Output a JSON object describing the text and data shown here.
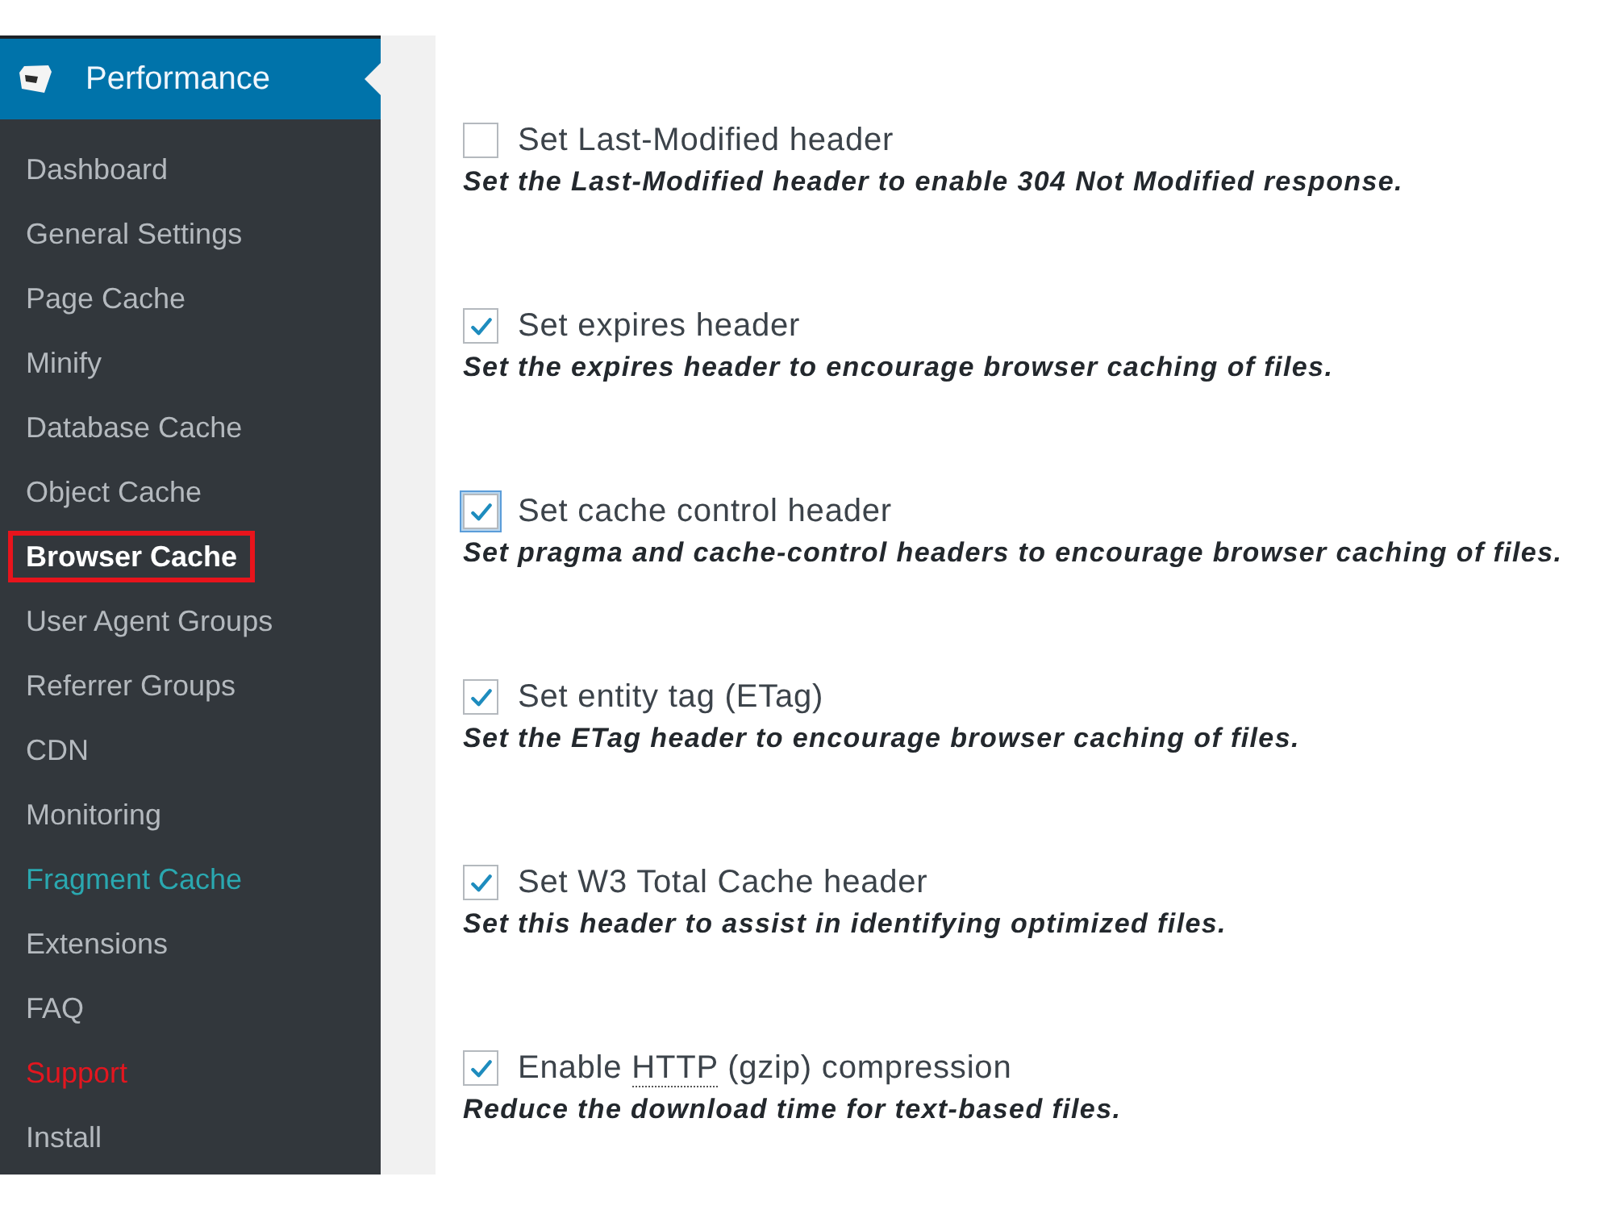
{
  "sidebar": {
    "header": {
      "title": "Performance"
    },
    "items": [
      {
        "label": "Dashboard",
        "selected": false,
        "marked": false,
        "color": "#b4b9be"
      },
      {
        "label": "General Settings",
        "selected": false,
        "marked": false,
        "color": "#b4b9be"
      },
      {
        "label": "Page Cache",
        "selected": false,
        "marked": false,
        "color": "#b4b9be"
      },
      {
        "label": "Minify",
        "selected": false,
        "marked": false,
        "color": "#b4b9be"
      },
      {
        "label": "Database Cache",
        "selected": false,
        "marked": false,
        "color": "#b4b9be"
      },
      {
        "label": "Object Cache",
        "selected": false,
        "marked": false,
        "color": "#b4b9be"
      },
      {
        "label": "Browser Cache",
        "selected": true,
        "marked": true,
        "color": "#ffffff"
      },
      {
        "label": "User Agent Groups",
        "selected": false,
        "marked": false,
        "color": "#b4b9be"
      },
      {
        "label": "Referrer Groups",
        "selected": false,
        "marked": false,
        "color": "#b4b9be"
      },
      {
        "label": "CDN",
        "selected": false,
        "marked": false,
        "color": "#b4b9be"
      },
      {
        "label": "Monitoring",
        "selected": false,
        "marked": false,
        "color": "#b4b9be"
      },
      {
        "label": "Fragment Cache",
        "selected": false,
        "marked": false,
        "color": "#2aa8b0"
      },
      {
        "label": "Extensions",
        "selected": false,
        "marked": false,
        "color": "#b4b9be"
      },
      {
        "label": "FAQ",
        "selected": false,
        "marked": false,
        "color": "#b4b9be"
      },
      {
        "label": "Support",
        "selected": false,
        "marked": false,
        "color": "#e3161f"
      },
      {
        "label": "Install",
        "selected": false,
        "marked": false,
        "color": "#b4b9be"
      }
    ]
  },
  "options": [
    {
      "label_parts": [
        {
          "text": "Set Last-Modified header",
          "dotted_underline": false
        }
      ],
      "checked": false,
      "focused": false,
      "description": "Set the Last-Modified header to enable 304 Not Modified response."
    },
    {
      "label_parts": [
        {
          "text": "Set expires header",
          "dotted_underline": false
        }
      ],
      "checked": true,
      "focused": false,
      "description": "Set the expires header to encourage browser caching of files."
    },
    {
      "label_parts": [
        {
          "text": "Set cache control header",
          "dotted_underline": false
        }
      ],
      "checked": true,
      "focused": true,
      "description": "Set pragma and cache-control headers to encourage browser caching of files."
    },
    {
      "label_parts": [
        {
          "text": "Set entity tag (ETag)",
          "dotted_underline": false
        }
      ],
      "checked": true,
      "focused": false,
      "description": "Set the ETag header to encourage browser caching of files."
    },
    {
      "label_parts": [
        {
          "text": "Set W3 Total Cache header",
          "dotted_underline": false
        }
      ],
      "checked": true,
      "focused": false,
      "description": "Set this header to assist in identifying optimized files."
    },
    {
      "label_parts": [
        {
          "text": "Enable ",
          "dotted_underline": false
        },
        {
          "text": "HTTP",
          "dotted_underline": true
        },
        {
          "text": " (gzip) compression",
          "dotted_underline": false
        }
      ],
      "checked": true,
      "focused": false,
      "description": "Reduce the download time for text-based files."
    }
  ]
}
